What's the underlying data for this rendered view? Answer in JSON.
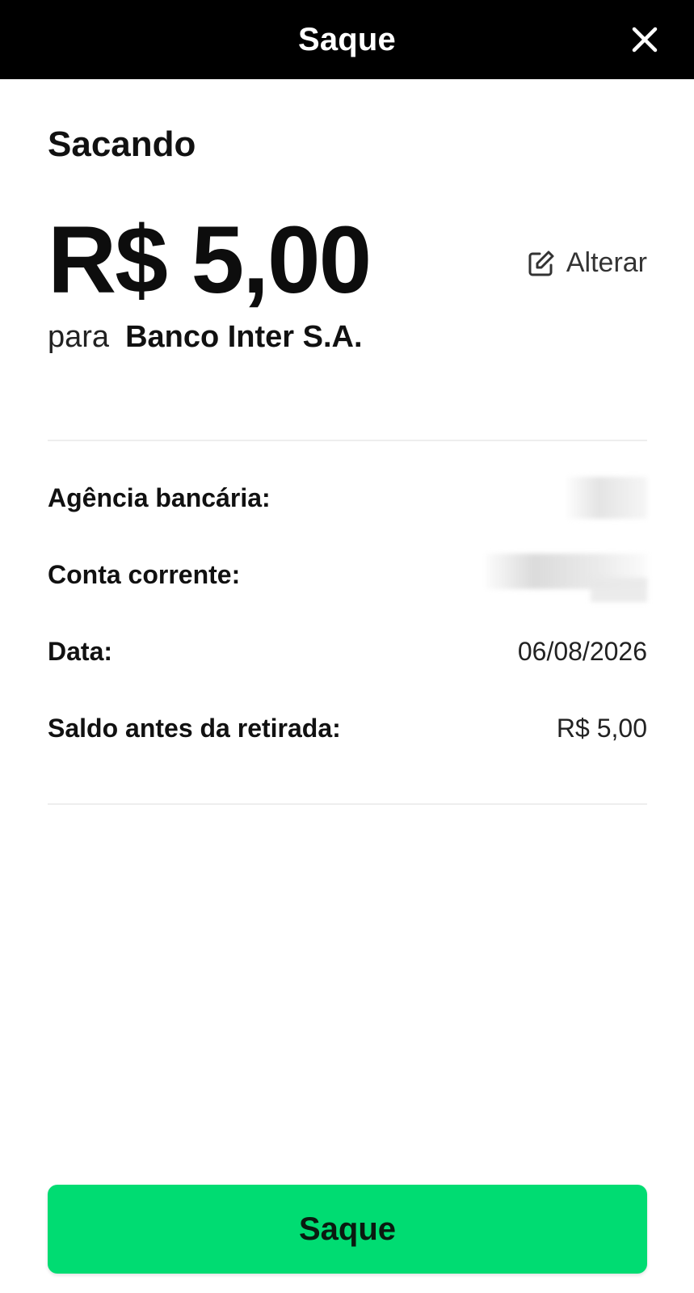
{
  "header": {
    "title": "Saque",
    "close_icon": "close-icon"
  },
  "summary": {
    "heading": "Sacando",
    "amount": "R$ 5,00",
    "edit_label": "Alterar",
    "edit_icon": "edit-icon",
    "recipient_prefix": "para",
    "recipient_bank": "Banco Inter S.A."
  },
  "details": [
    {
      "label": "Agência bancária:",
      "value": "",
      "redacted": true
    },
    {
      "label": "Conta corrente:",
      "value": "",
      "redacted": true
    },
    {
      "label": "Data:",
      "value": "06/08/2026",
      "redacted": false
    },
    {
      "label": "Saldo antes da retirada:",
      "value": "R$ 5,00",
      "redacted": false
    }
  ],
  "footer": {
    "submit_label": "Saque"
  },
  "colors": {
    "header_bg": "#000000",
    "accent": "#00dc72"
  }
}
